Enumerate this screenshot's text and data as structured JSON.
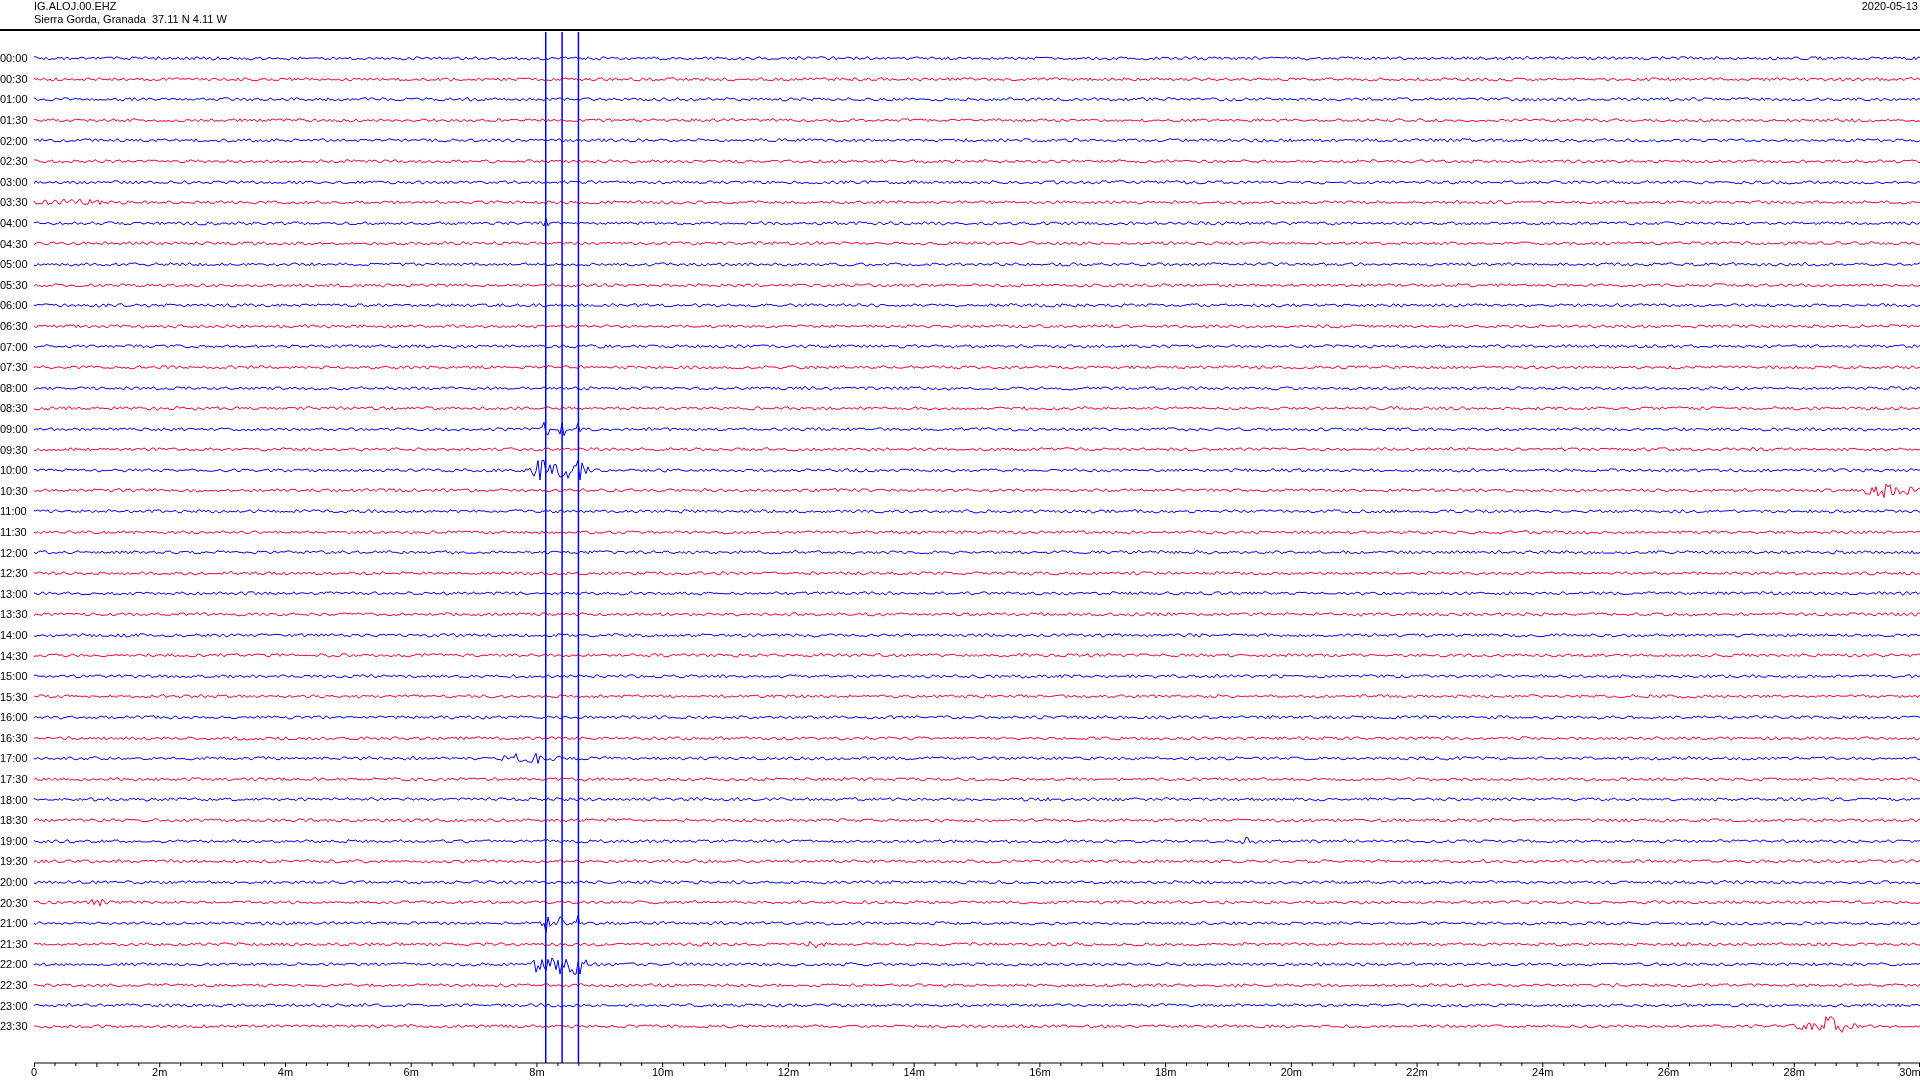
{
  "header": {
    "station": "IG.ALOJ.00.EHZ",
    "location": "Sierra Gorda, Granada  37.11 N 4.11 W",
    "date": "2020-05-13"
  },
  "rows": [
    {
      "label": "00:00",
      "color": "#0000ff"
    },
    {
      "label": "00:30",
      "color": "#ff0033"
    },
    {
      "label": "01:00",
      "color": "#0000ff"
    },
    {
      "label": "01:30",
      "color": "#ff0033"
    },
    {
      "label": "02:00",
      "color": "#0000ff"
    },
    {
      "label": "02:30",
      "color": "#ff0033"
    },
    {
      "label": "03:00",
      "color": "#0000ff"
    },
    {
      "label": "03:30",
      "color": "#ff0033"
    },
    {
      "label": "04:00",
      "color": "#0000ff"
    },
    {
      "label": "04:30",
      "color": "#ff0033"
    },
    {
      "label": "05:00",
      "color": "#0000ff"
    },
    {
      "label": "05:30",
      "color": "#ff0033"
    },
    {
      "label": "06:00",
      "color": "#0000ff"
    },
    {
      "label": "06:30",
      "color": "#ff0033"
    },
    {
      "label": "07:00",
      "color": "#0000ff"
    },
    {
      "label": "07:30",
      "color": "#ff0033"
    },
    {
      "label": "08:00",
      "color": "#0000ff"
    },
    {
      "label": "08:30",
      "color": "#ff0033"
    },
    {
      "label": "09:00",
      "color": "#0000ff"
    },
    {
      "label": "09:30",
      "color": "#ff0033"
    },
    {
      "label": "10:00",
      "color": "#0000ff"
    },
    {
      "label": "10:30",
      "color": "#ff0033"
    },
    {
      "label": "11:00",
      "color": "#0000ff"
    },
    {
      "label": "11:30",
      "color": "#ff0033"
    },
    {
      "label": "12:00",
      "color": "#0000ff"
    },
    {
      "label": "12:30",
      "color": "#ff0033"
    },
    {
      "label": "13:00",
      "color": "#0000ff"
    },
    {
      "label": "13:30",
      "color": "#ff0033"
    },
    {
      "label": "14:00",
      "color": "#0000ff"
    },
    {
      "label": "14:30",
      "color": "#ff0033"
    },
    {
      "label": "15:00",
      "color": "#0000ff"
    },
    {
      "label": "15:30",
      "color": "#ff0033"
    },
    {
      "label": "16:00",
      "color": "#0000ff"
    },
    {
      "label": "16:30",
      "color": "#ff0033"
    },
    {
      "label": "17:00",
      "color": "#0000ff"
    },
    {
      "label": "17:30",
      "color": "#ff0033"
    },
    {
      "label": "18:00",
      "color": "#0000ff"
    },
    {
      "label": "18:30",
      "color": "#ff0033"
    },
    {
      "label": "19:00",
      "color": "#0000ff"
    },
    {
      "label": "19:30",
      "color": "#ff0033"
    },
    {
      "label": "20:00",
      "color": "#0000ff"
    },
    {
      "label": "20:30",
      "color": "#ff0033"
    },
    {
      "label": "21:00",
      "color": "#0000ff"
    },
    {
      "label": "21:30",
      "color": "#ff0033"
    },
    {
      "label": "22:00",
      "color": "#0000ff"
    },
    {
      "label": "22:30",
      "color": "#ff0033"
    },
    {
      "label": "23:00",
      "color": "#0000ff"
    },
    {
      "label": "23:30",
      "color": "#ff0033"
    }
  ],
  "axis": {
    "labels": [
      "0",
      "2m",
      "4m",
      "6m",
      "8m",
      "10m",
      "12m",
      "14m",
      "16m",
      "18m",
      "20m",
      "22m",
      "24m",
      "26m",
      "28m",
      "30m"
    ]
  }
}
